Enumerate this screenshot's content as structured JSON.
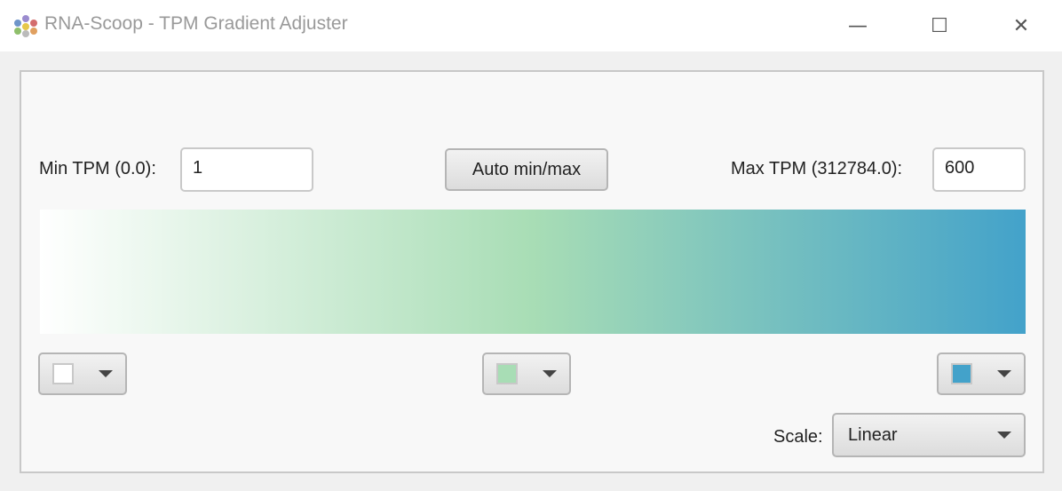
{
  "window": {
    "title": "RNA-Scoop - TPM Gradient Adjuster",
    "minimize": "—",
    "maximize": "☐",
    "close": "✕"
  },
  "min_tpm": {
    "label": "Min TPM (0.0):",
    "value": "1"
  },
  "auto_button": "Auto min/max",
  "max_tpm": {
    "label": "Max TPM (312784.0):",
    "value": "600"
  },
  "colors": {
    "min": "#ffffff",
    "mid": "#a8ddb5",
    "max": "#43a2ca"
  },
  "scale": {
    "label": "Scale:",
    "value": "Linear"
  }
}
